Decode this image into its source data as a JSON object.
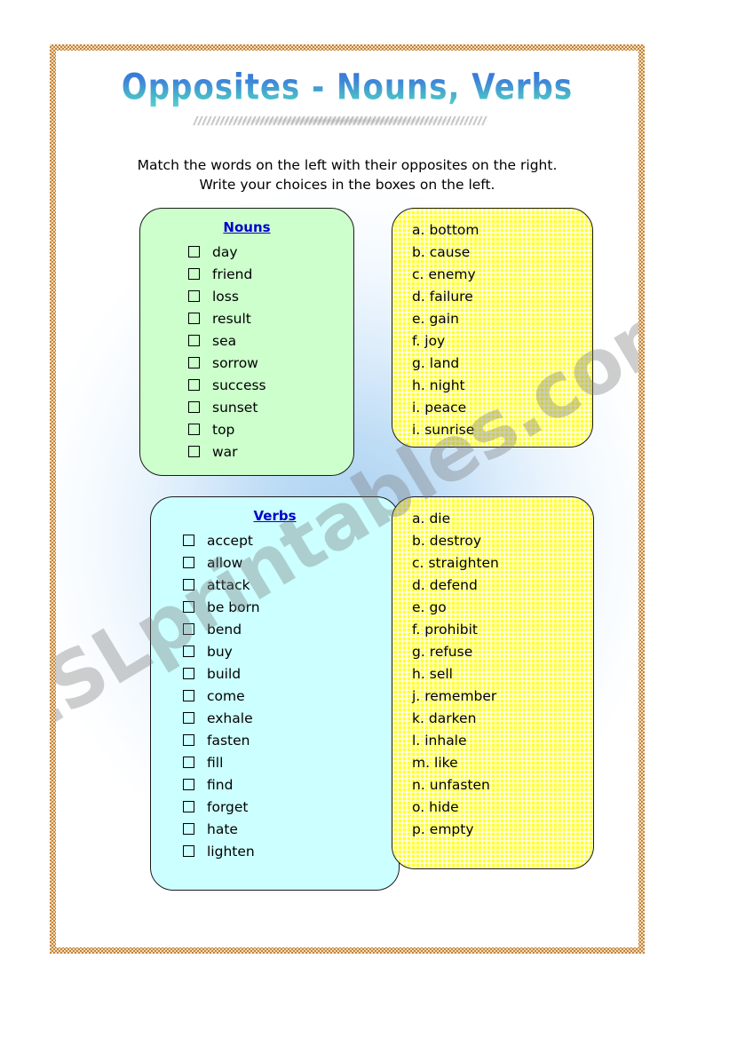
{
  "page": {
    "title": "Opposites - Nouns, Verbs",
    "watermark": "ESLprintables.com",
    "instructions": {
      "line1": "Match the words on the left with their opposites on the right.",
      "line2": "Write your choices in the boxes on the left."
    },
    "colors": {
      "nouns_card": "#ccffcc",
      "verbs_card": "#ccffff",
      "answers_card": "#ffff33",
      "heading_text": "#0000cc",
      "frame": "#c3853a",
      "body_text": "#000000"
    }
  },
  "nouns_card": {
    "heading": "Nouns",
    "items": [
      {
        "word": "day"
      },
      {
        "word": "friend"
      },
      {
        "word": "loss"
      },
      {
        "word": "result"
      },
      {
        "word": "sea"
      },
      {
        "word": "sorrow"
      },
      {
        "word": "success"
      },
      {
        "word": "sunset"
      },
      {
        "word": "top"
      },
      {
        "word": "war"
      }
    ]
  },
  "nouns_answers": {
    "options": [
      {
        "letter": "a.",
        "word": "bottom"
      },
      {
        "letter": "b.",
        "word": "cause"
      },
      {
        "letter": "c.",
        "word": "enemy"
      },
      {
        "letter": "d.",
        "word": "failure"
      },
      {
        "letter": "e.",
        "word": "gain"
      },
      {
        "letter": "f.",
        "word": "joy"
      },
      {
        "letter": "g.",
        "word": "land"
      },
      {
        "letter": "h.",
        "word": "night"
      },
      {
        "letter": "i.",
        "word": "peace"
      },
      {
        "letter": "i.",
        "word": "sunrise"
      }
    ]
  },
  "verbs_card": {
    "heading": "Verbs",
    "items": [
      {
        "word": "accept"
      },
      {
        "word": "allow"
      },
      {
        "word": "attack"
      },
      {
        "word": "be born"
      },
      {
        "word": "bend"
      },
      {
        "word": "buy"
      },
      {
        "word": "build"
      },
      {
        "word": "come"
      },
      {
        "word": "exhale"
      },
      {
        "word": "fasten"
      },
      {
        "word": "fill"
      },
      {
        "word": "find"
      },
      {
        "word": "forget"
      },
      {
        "word": "hate"
      },
      {
        "word": "lighten"
      }
    ]
  },
  "verbs_answers": {
    "options": [
      {
        "letter": "a.",
        "word": "die"
      },
      {
        "letter": "b.",
        "word": "destroy"
      },
      {
        "letter": "c.",
        "word": "straighten"
      },
      {
        "letter": "d.",
        "word": "defend"
      },
      {
        "letter": "e.",
        "word": "go"
      },
      {
        "letter": "f.",
        "word": "prohibit"
      },
      {
        "letter": "g.",
        "word": "refuse"
      },
      {
        "letter": "h.",
        "word": "sell"
      },
      {
        "letter": "j.",
        "word": "remember"
      },
      {
        "letter": "k.",
        "word": "darken"
      },
      {
        "letter": "l.",
        "word": "inhale"
      },
      {
        "letter": "m.",
        "word": "like"
      },
      {
        "letter": "n.",
        "word": "unfasten"
      },
      {
        "letter": "o.",
        "word": "hide"
      },
      {
        "letter": "p.",
        "word": "empty"
      }
    ]
  }
}
